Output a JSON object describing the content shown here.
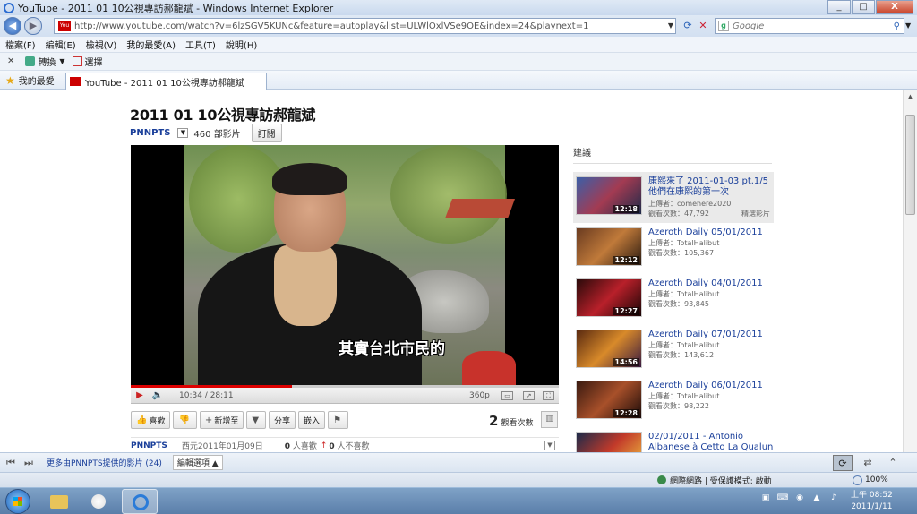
{
  "window": {
    "title": "YouTube - 2011 01 10公視專訪郝龍斌 - Windows Internet Explorer",
    "buttons": [
      "_",
      "□",
      "X"
    ]
  },
  "address": {
    "url": "http://www.youtube.com/watch?v=6lzSGV5KUNc&feature=autoplay&list=ULWlOxlVSe9OE&index=24&playnext=1",
    "search_placeholder": "Google"
  },
  "menu": [
    "檔案(F)",
    "編輯(E)",
    "檢視(V)",
    "我的最愛(A)",
    "工具(T)",
    "說明(H)"
  ],
  "toolbar2": {
    "translate": "轉換",
    "select": "選擇"
  },
  "favorites": {
    "label": "我的最愛",
    "tab_title": "YouTube - 2011 01 10公視專訪郝龍斌"
  },
  "video": {
    "title": "2011 01 10公視專訪郝龍斌",
    "channel": "PNNPTS",
    "video_count": "460 部影片",
    "subscribe": "訂閱",
    "subtitle": "其實台北市民的",
    "time": "10:34 / 28:11",
    "progress": 0.376,
    "quality": "360p",
    "actions": {
      "like": "喜歡",
      "add": "新增至",
      "share": "分享",
      "embed": "嵌入"
    },
    "views_num": "2",
    "views_label": "觀看次數",
    "info": {
      "channel": "PNNPTS",
      "date": "西元2011年01月09日",
      "likes": "0",
      "likes_label": "人喜歡",
      "dislikes": "0",
      "dislikes_label": "人不喜歡"
    }
  },
  "suggestions": {
    "header": "建議",
    "items": [
      {
        "title": "康熙來了 2011-01-03 pt.1/5 他們在康熙的第一次",
        "uploader": "上傳者：comehere2020",
        "views": "觀看次數：47,792",
        "duration": "12:18",
        "featured": "精選影片"
      },
      {
        "title": "Azeroth Daily 05/01/2011",
        "uploader": "上傳者：TotalHalibut",
        "views": "觀看次數：105,367",
        "duration": "12:12",
        "featured": ""
      },
      {
        "title": "Azeroth Daily 04/01/2011",
        "uploader": "上傳者：TotalHalibut",
        "views": "觀看次數：93,845",
        "duration": "12:27",
        "featured": ""
      },
      {
        "title": "Azeroth Daily 07/01/2011",
        "uploader": "上傳者：TotalHalibut",
        "views": "觀看次數：143,612",
        "duration": "14:56",
        "featured": ""
      },
      {
        "title": "Azeroth Daily 06/01/2011",
        "uploader": "上傳者：TotalHalibut",
        "views": "觀看次數：98,222",
        "duration": "12:28",
        "featured": ""
      },
      {
        "title": "02/01/2011 - Antonio Albanese à Cetto La Qualun",
        "uploader": "",
        "views": "",
        "duration": "",
        "featured": ""
      }
    ]
  },
  "bottombar": {
    "more": "更多由PNNPTS提供的影片 (24)",
    "edit": "編輯選項 ▲"
  },
  "status": {
    "zone": "網際網路 | 受保護模式: 啟動",
    "zoom": "100%"
  },
  "clock": {
    "time": "上午 08:52",
    "date": "2011/1/11"
  }
}
